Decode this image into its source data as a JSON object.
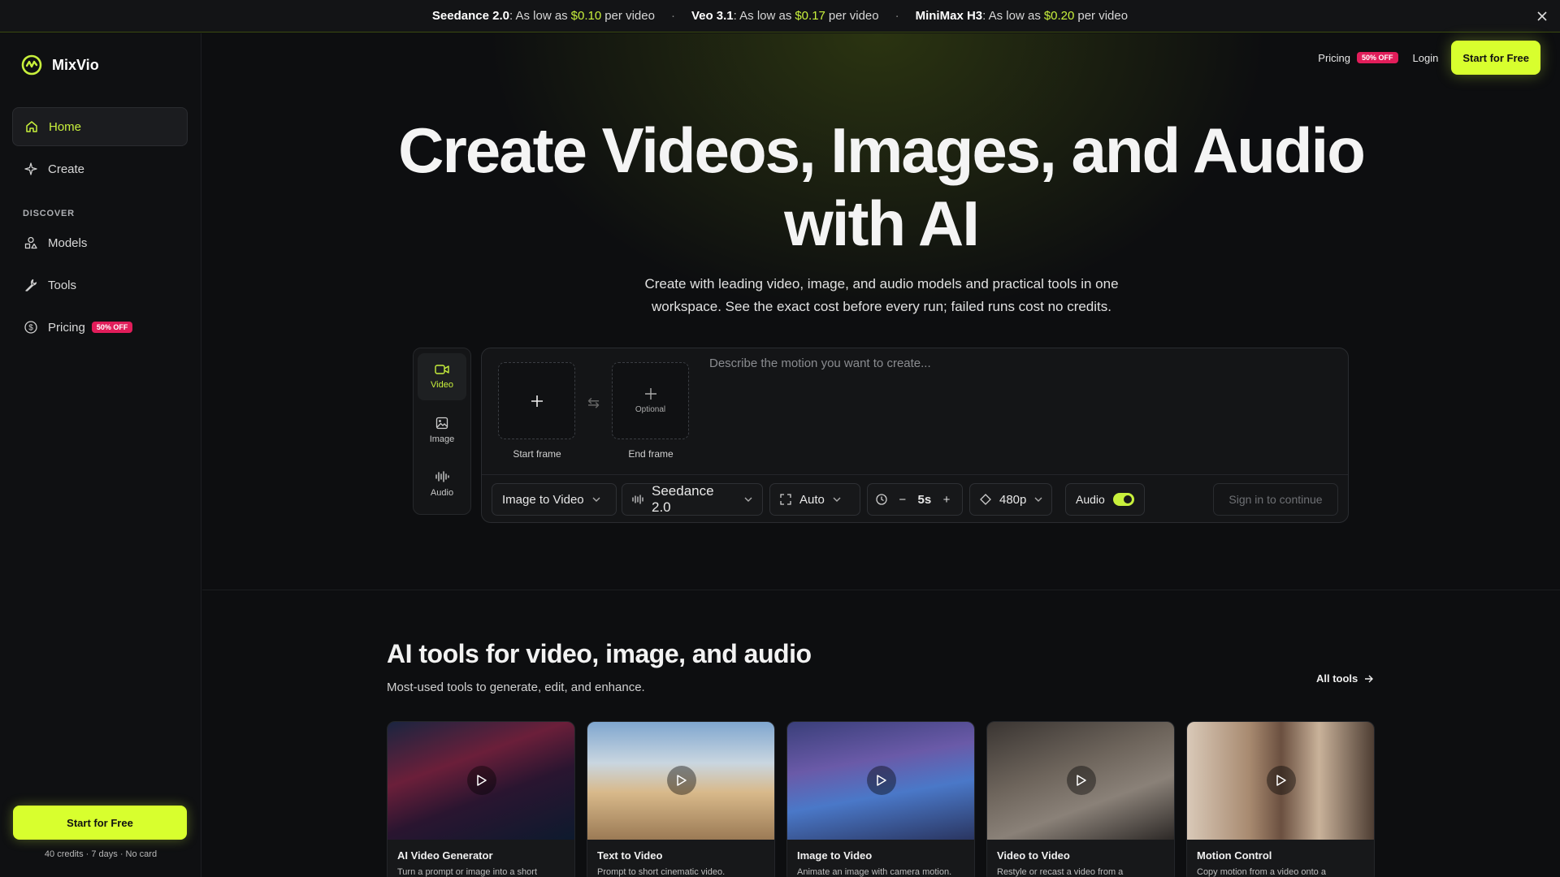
{
  "banner": {
    "promos": [
      {
        "model": "Seedance 2.0",
        "prefix": ": As low as",
        "price": "$0.10",
        "suffix": "per video"
      },
      {
        "model": "Veo 3.1",
        "prefix": ": As low as",
        "price": "$0.17",
        "suffix": "per video"
      },
      {
        "model": "MiniMax H3",
        "prefix": ": As low as",
        "price": "$0.20",
        "suffix": "per video"
      }
    ],
    "separator": "·",
    "close_icon": "close-icon"
  },
  "brand": {
    "name": "MixVio",
    "accent": "#c8f03c"
  },
  "sidebar": {
    "items": [
      {
        "label": "Home",
        "icon": "home-icon"
      },
      {
        "label": "Create",
        "icon": "sparkle-icon"
      }
    ],
    "section_label": "DISCOVER",
    "discover": [
      {
        "label": "Models",
        "icon": "shapes-icon"
      },
      {
        "label": "Tools",
        "icon": "wrench-icon"
      },
      {
        "label": "Pricing",
        "icon": "dollar-icon",
        "badge": "50% OFF"
      }
    ],
    "cta_label": "Start for Free",
    "cta_note": "40 credits · 7 days · No card"
  },
  "topnav": {
    "pricing": "Pricing",
    "pricing_badge": "50% OFF",
    "login": "Login",
    "cta": "Start for Free"
  },
  "hero": {
    "title_line1": "Create Videos, Images, and Audio",
    "title_line2": "with AI",
    "subtitle": "Create with leading video, image, and audio models and practical tools in one workspace. See the exact cost before every run; failed runs cost no credits."
  },
  "modes": [
    {
      "label": "Video",
      "icon": "video-icon",
      "active": true
    },
    {
      "label": "Image",
      "icon": "image-icon",
      "active": false
    },
    {
      "label": "Audio",
      "icon": "audio-wave-icon",
      "active": false
    }
  ],
  "composer": {
    "start_frame_label": "Start frame",
    "end_frame_label": "End frame",
    "end_frame_optional": "Optional",
    "prompt_placeholder": "Describe the motion you want to create...",
    "controls": {
      "task": "Image to Video",
      "model": "Seedance 2.0",
      "aspect": "Auto",
      "duration": "5s",
      "resolution": "480p",
      "audio_label": "Audio",
      "audio_on": true
    },
    "submit": "Sign in to continue"
  },
  "tools_section": {
    "title": "AI tools for video, image, and audio",
    "subtitle": "Most-used tools to generate, edit, and enhance.",
    "all_tools": "All tools",
    "cards": [
      {
        "title": "AI Video Generator",
        "desc": "Turn a prompt or image into a short"
      },
      {
        "title": "Text to Video",
        "desc": "Prompt to short cinematic video."
      },
      {
        "title": "Image to Video",
        "desc": "Animate an image with camera motion."
      },
      {
        "title": "Video to Video",
        "desc": "Restyle or recast a video from a"
      },
      {
        "title": "Motion Control",
        "desc": "Copy motion from a video onto a"
      }
    ]
  }
}
